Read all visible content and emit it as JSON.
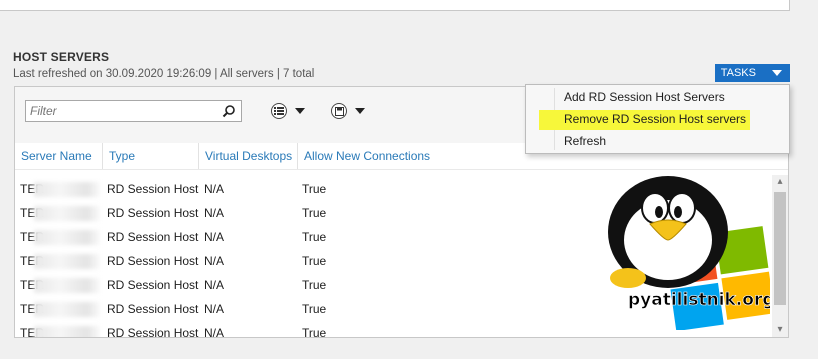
{
  "section": {
    "title": "HOST SERVERS",
    "subtitle": "Last refreshed on 30.09.2020 19:26:09 | All servers  | 7 total"
  },
  "tasks_label": "TASKS",
  "filter": {
    "placeholder": "Filter",
    "value": ""
  },
  "columns": [
    "Server Name",
    "Type",
    "Virtual Desktops",
    "Allow New Connections"
  ],
  "rows": [
    {
      "server": "TER",
      "type": "RD Session Host",
      "vd": "N/A",
      "allow": "True"
    },
    {
      "server": "TER",
      "type": "RD Session Host",
      "vd": "N/A",
      "allow": "True"
    },
    {
      "server": "TER",
      "type": "RD Session Host",
      "vd": "N/A",
      "allow": "True"
    },
    {
      "server": "TER",
      "type": "RD Session Host",
      "vd": "N/A",
      "allow": "True"
    },
    {
      "server": "TER",
      "type": "RD Session Host",
      "vd": "N/A",
      "allow": "True"
    },
    {
      "server": "TER",
      "type": "RD Session Host",
      "vd": "N/A",
      "allow": "True"
    },
    {
      "server": "TER",
      "type": "RD Session Host",
      "vd": "N/A",
      "allow": "True"
    }
  ],
  "menu": [
    "Add RD Session Host Servers",
    "Remove RD Session Host servers",
    "Refresh"
  ],
  "watermark": "pyatilistnik.org",
  "colors": {
    "accent": "#1a6fc4",
    "header_text": "#2a7ab8",
    "highlight": "#f7f73a"
  }
}
